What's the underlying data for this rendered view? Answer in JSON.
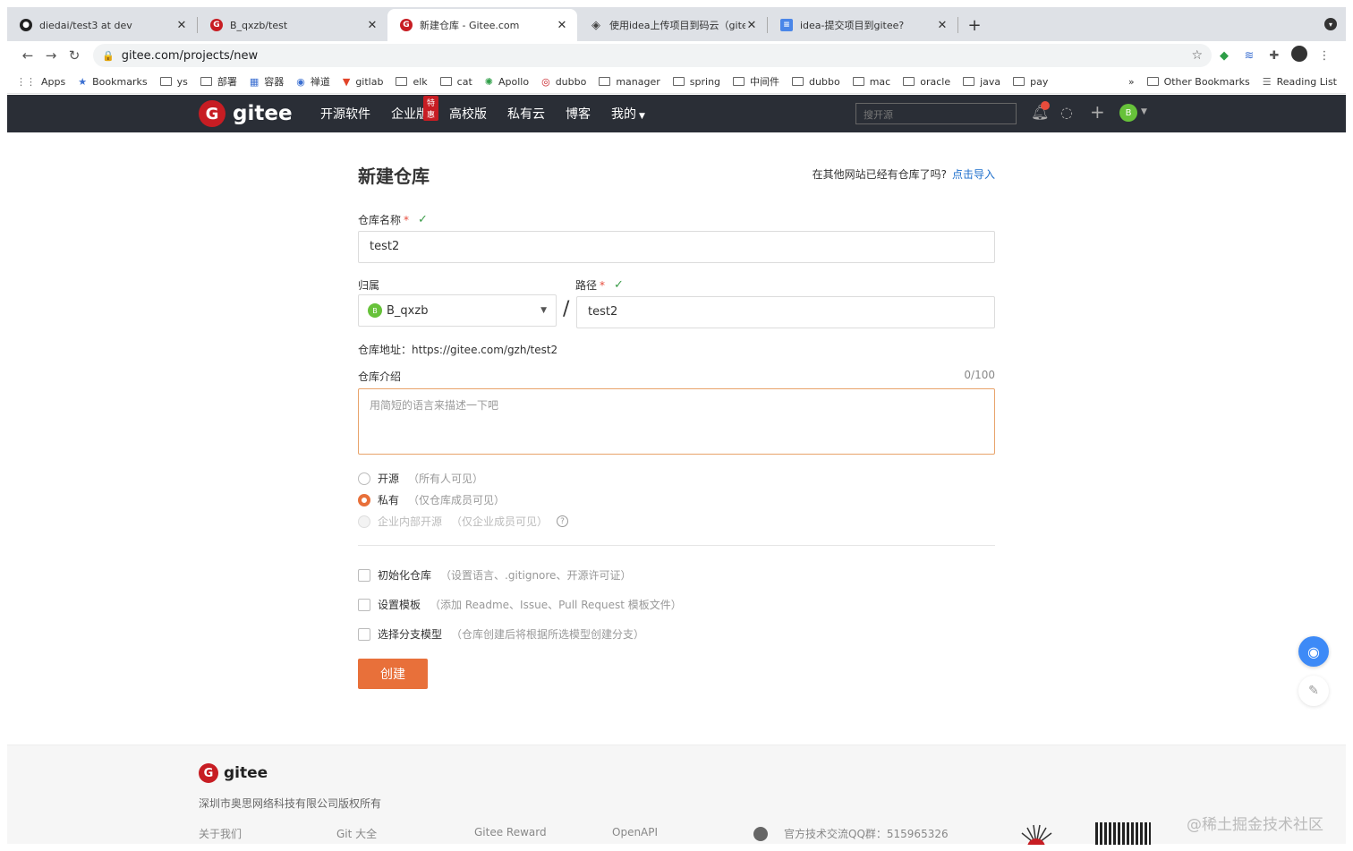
{
  "browser": {
    "tabs": [
      {
        "title": "diedai/test3 at dev",
        "icon": "github-icon",
        "active": false
      },
      {
        "title": "B_qxzb/test",
        "icon": "gitee-icon",
        "active": false
      },
      {
        "title": "新建仓库 - Gitee.com",
        "icon": "gitee-icon",
        "active": true
      },
      {
        "title": "使用idea上传项目到码云（gitee",
        "icon": "extension-icon",
        "active": false
      },
      {
        "title": "idea-提交项目到gitee?",
        "icon": "doc-icon",
        "active": false
      }
    ],
    "url": "gitee.com/projects/new",
    "bookmarks": [
      "Apps",
      "Bookmarks",
      "ys",
      "部署",
      "容器",
      "禅道",
      "gitlab",
      "elk",
      "cat",
      "Apollo",
      "dubbo",
      "manager",
      "spring",
      "中间件",
      "dubbo",
      "mac",
      "oracle",
      "java",
      "pay"
    ],
    "bookmarks_overflow": "»",
    "other_bookmarks": "Other Bookmarks",
    "reading_list": "Reading List"
  },
  "header": {
    "logo_text": "gitee",
    "nav": [
      "开源软件",
      "企业版",
      "高校版",
      "私有云",
      "博客",
      "我的"
    ],
    "hot_badge": "特惠",
    "search_placeholder": "搜开源",
    "user_initial": "B"
  },
  "form": {
    "title": "新建仓库",
    "import_hint": "在其他网站已经有仓库了吗?",
    "import_link": "点击导入",
    "repo_name_label": "仓库名称",
    "repo_name_value": "test2",
    "owner_label": "归属",
    "owner_initial": "B",
    "owner_value": "B_qxzb",
    "path_label": "路径",
    "path_value": "test2",
    "slash": "/",
    "repo_url_label": "仓库地址：",
    "repo_url_value": "https://gitee.com/gzh/test2",
    "intro_label": "仓库介绍",
    "intro_counter": "0/100",
    "intro_placeholder": "用简短的语言来描述一下吧",
    "visibility": [
      {
        "label": "开源",
        "hint": "（所有人可见）",
        "state": "off"
      },
      {
        "label": "私有",
        "hint": "（仅仓库成员可见）",
        "state": "on"
      },
      {
        "label": "企业内部开源",
        "hint": "（仅企业成员可见）",
        "state": "disabled"
      }
    ],
    "options": [
      {
        "label": "初始化仓库",
        "hint": "（设置语言、.gitignore、开源许可证）"
      },
      {
        "label": "设置模板",
        "hint": "（添加 Readme、Issue、Pull Request 模板文件）"
      },
      {
        "label": "选择分支模型",
        "hint": "（仓库创建后将根据所选模型创建分支）"
      }
    ],
    "create_button": "创建"
  },
  "footer": {
    "logo_text": "gitee",
    "copyright": "深圳市奥思网络科技有限公司版权所有",
    "links": [
      "关于我们",
      "Git 大全",
      "Gitee Reward",
      "OpenAPI"
    ],
    "qq_group": "官方技术交流QQ群：515965326",
    "watermark": "@稀土掘金技术社区"
  },
  "colors": {
    "accent_orange": "#e8703a",
    "gitee_red": "#c71d23",
    "header_dark": "#2a2e36",
    "link_blue": "#1e6fcc",
    "check_green": "#3c9d4a"
  }
}
